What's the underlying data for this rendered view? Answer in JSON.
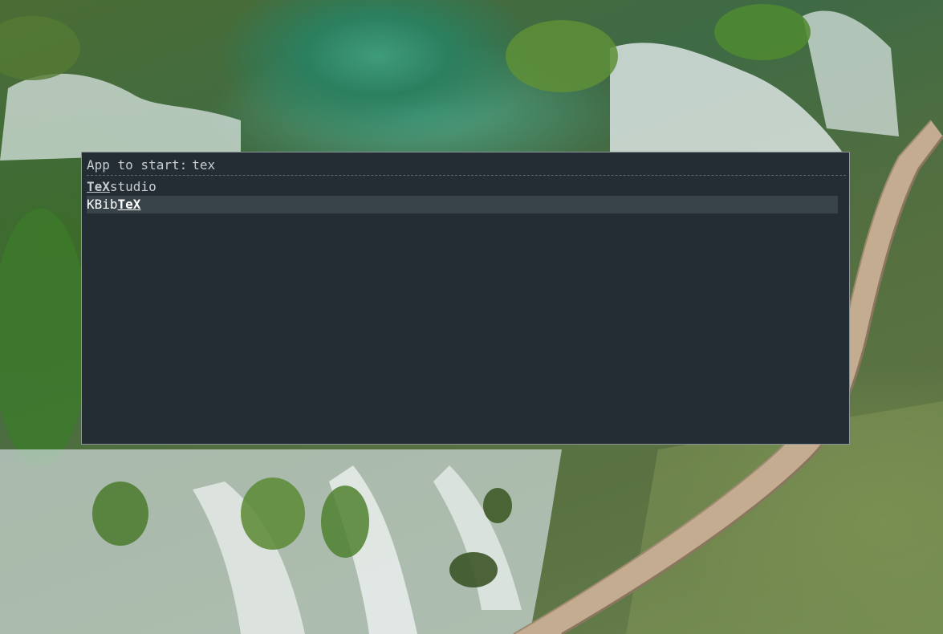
{
  "launcher": {
    "prompt_label": "App to start:",
    "query": "tex",
    "results": [
      {
        "before": "",
        "match": "TeX",
        "after": "studio",
        "selected": false
      },
      {
        "before": "KBib",
        "match": "TeX",
        "after": "",
        "selected": true
      }
    ]
  },
  "colors": {
    "panel_background": "#242d34",
    "panel_border": "#8c959c",
    "text": "#c9cdd0",
    "selected_row": "#39434a"
  }
}
